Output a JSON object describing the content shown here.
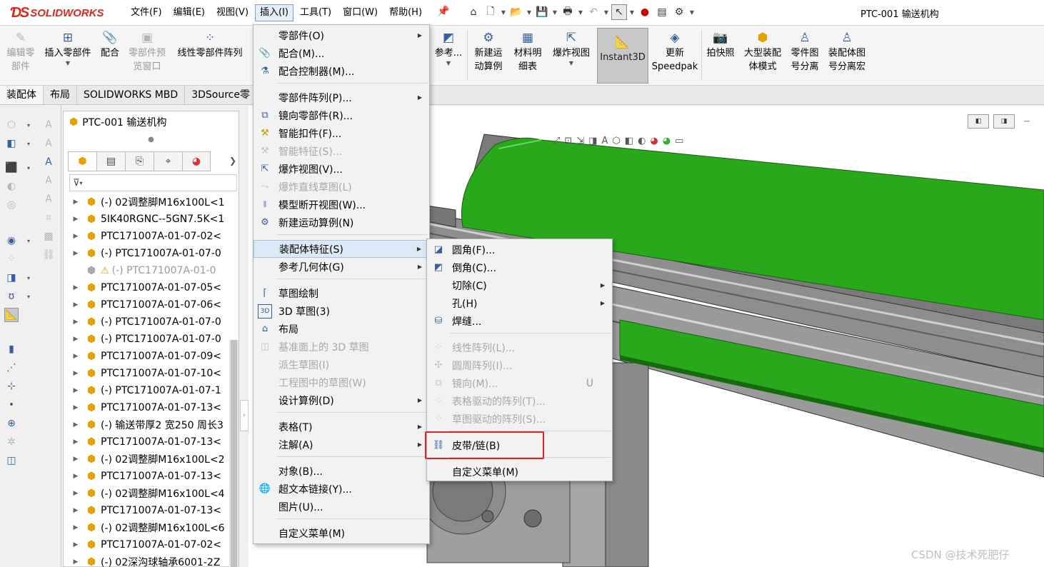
{
  "app": {
    "logo_text": "SOLIDWORKS",
    "doc_title": "PTC-001 输送机构"
  },
  "menubar": [
    "文件(F)",
    "编辑(E)",
    "视图(V)",
    "插入(I)",
    "工具(T)",
    "窗口(W)",
    "帮助(H)"
  ],
  "ribbon": {
    "edit_component": "编辑零\n部件",
    "insert_component": "插入零部件",
    "mate": "配合",
    "component_preview": "零部件预\n览窗口",
    "linear_pattern": "线性零部件阵列",
    "reference": "参考...",
    "new_motion_study": "新建运\n动算例",
    "bom": "材料明\n细表",
    "exploded_view": "爆炸视图",
    "instant3d": "Instant3D",
    "update_speedpak": "更新\nSpeedpak",
    "snapshot": "拍快照",
    "large_assembly_mode": "大型装配\n体模式",
    "part_id_split": "零件图\n号分离",
    "assembly_id_split": "装配体图\n号分离宏"
  },
  "tabs": [
    "装配体",
    "布局",
    "SOLIDWORKS MBD",
    "3DSource零"
  ],
  "tree": {
    "title": "PTC-001 输送机构",
    "items": [
      {
        "text": "(-) 02调整脚M16x100L<1",
        "state": "normal"
      },
      {
        "text": "5IK40RGNC--5GN7.5K<1",
        "state": "normal"
      },
      {
        "text": "PTC171007A-01-07-02<",
        "state": "normal"
      },
      {
        "text": "(-) PTC171007A-01-07-0",
        "state": "normal"
      },
      {
        "text": "(-) PTC171007A-01-0",
        "state": "warning"
      },
      {
        "text": "PTC171007A-01-07-05<",
        "state": "normal"
      },
      {
        "text": "PTC171007A-01-07-06<",
        "state": "normal"
      },
      {
        "text": "(-) PTC171007A-01-07-0",
        "state": "normal"
      },
      {
        "text": "(-) PTC171007A-01-07-0",
        "state": "normal"
      },
      {
        "text": "PTC171007A-01-07-09<",
        "state": "normal"
      },
      {
        "text": "PTC171007A-01-07-10<",
        "state": "normal"
      },
      {
        "text": "(-) PTC171007A-01-07-1",
        "state": "normal"
      },
      {
        "text": "PTC171007A-01-07-13<",
        "state": "normal"
      },
      {
        "text": "(-) 输送带厚2 宽250 周长3",
        "state": "normal"
      },
      {
        "text": "PTC171007A-01-07-13<",
        "state": "normal"
      },
      {
        "text": "(-) 02调整脚M16x100L<2",
        "state": "normal"
      },
      {
        "text": "PTC171007A-01-07-13<",
        "state": "normal"
      },
      {
        "text": "(-) 02调整脚M16x100L<4",
        "state": "normal"
      },
      {
        "text": "PTC171007A-01-07-13<",
        "state": "normal"
      },
      {
        "text": "(-) 02调整脚M16x100L<6",
        "state": "normal"
      },
      {
        "text": "PTC171007A-01-07-02<",
        "state": "normal"
      },
      {
        "text": "(-) 02深沟球轴承6001-2Z",
        "state": "normal"
      }
    ]
  },
  "insert_menu": {
    "items": [
      {
        "label": "零部件(O)",
        "icon": "component-icon",
        "submenu": true,
        "disabled": false
      },
      {
        "label": "配合(M)...",
        "icon": "mate-icon",
        "submenu": false,
        "disabled": false
      },
      {
        "label": "配合控制器(M)...",
        "icon": "mate-controller-icon",
        "submenu": false,
        "disabled": false
      },
      {
        "label": "零部件阵列(P)...",
        "icon": "",
        "submenu": true,
        "disabled": false
      },
      {
        "label": "镜向零部件(R)...",
        "icon": "mirror-icon",
        "submenu": false,
        "disabled": false
      },
      {
        "label": "智能扣件(F)...",
        "icon": "smart-fastener-icon",
        "submenu": false,
        "disabled": false
      },
      {
        "label": "智能特征(S)...",
        "icon": "smart-feature-icon",
        "submenu": false,
        "disabled": true
      },
      {
        "label": "爆炸视图(V)...",
        "icon": "explode-icon",
        "submenu": false,
        "disabled": false
      },
      {
        "label": "爆炸直线草图(L)",
        "icon": "explode-line-icon",
        "submenu": false,
        "disabled": true
      },
      {
        "label": "模型断开视图(W)...",
        "icon": "break-view-icon",
        "submenu": false,
        "disabled": false
      },
      {
        "label": "新建运动算例(N)",
        "icon": "motion-study-icon",
        "submenu": false,
        "disabled": false
      },
      {
        "label": "装配体特征(S)",
        "icon": "",
        "submenu": true,
        "disabled": false,
        "highlight": true
      },
      {
        "label": "参考几何体(G)",
        "icon": "",
        "submenu": true,
        "disabled": false
      },
      {
        "label": "草图绘制",
        "icon": "sketch-icon",
        "submenu": false,
        "disabled": false
      },
      {
        "label": "3D 草图(3)",
        "icon": "3d-sketch-icon",
        "submenu": false,
        "disabled": false
      },
      {
        "label": "布局",
        "icon": "layout-icon",
        "submenu": false,
        "disabled": false
      },
      {
        "label": "基准面上的 3D 草图",
        "icon": "3d-sketch-plane-icon",
        "submenu": false,
        "disabled": true
      },
      {
        "label": "派生草图(I)",
        "icon": "",
        "submenu": false,
        "disabled": true
      },
      {
        "label": "工程图中的草图(W)",
        "icon": "",
        "submenu": false,
        "disabled": true
      },
      {
        "label": "设计算例(D)",
        "icon": "",
        "submenu": true,
        "disabled": false
      },
      {
        "label": "表格(T)",
        "icon": "",
        "submenu": true,
        "disabled": false
      },
      {
        "label": "注解(A)",
        "icon": "",
        "submenu": true,
        "disabled": false
      },
      {
        "label": "对象(B)...",
        "icon": "",
        "submenu": false,
        "disabled": false
      },
      {
        "label": "超文本链接(Y)...",
        "icon": "hyperlink-icon",
        "submenu": false,
        "disabled": false
      },
      {
        "label": "图片(U)...",
        "icon": "",
        "submenu": false,
        "disabled": false
      },
      {
        "label": "自定义菜单(M)",
        "icon": "",
        "submenu": false,
        "disabled": false
      }
    ]
  },
  "assembly_feature_menu": {
    "items": [
      {
        "label": "圆角(F)...",
        "icon": "fillet-icon",
        "submenu": false,
        "disabled": false,
        "shortcut": ""
      },
      {
        "label": "倒角(C)...",
        "icon": "chamfer-icon",
        "submenu": false,
        "disabled": false,
        "shortcut": ""
      },
      {
        "label": "切除(C)",
        "icon": "",
        "submenu": true,
        "disabled": false,
        "shortcut": ""
      },
      {
        "label": "孔(H)",
        "icon": "",
        "submenu": true,
        "disabled": false,
        "shortcut": ""
      },
      {
        "label": "焊缝...",
        "icon": "weld-bead-icon",
        "submenu": false,
        "disabled": false,
        "shortcut": ""
      },
      {
        "label": "线性阵列(L)...",
        "icon": "linear-pattern-icon",
        "submenu": false,
        "disabled": true,
        "shortcut": ""
      },
      {
        "label": "圆周阵列(I)...",
        "icon": "circular-pattern-icon",
        "submenu": false,
        "disabled": true,
        "shortcut": ""
      },
      {
        "label": "镜向(M)...",
        "icon": "mirror-feature-icon",
        "submenu": false,
        "disabled": true,
        "shortcut": "U"
      },
      {
        "label": "表格驱动的阵列(T)...",
        "icon": "table-pattern-icon",
        "submenu": false,
        "disabled": true,
        "shortcut": ""
      },
      {
        "label": "草图驱动的阵列(S)...",
        "icon": "sketch-pattern-icon",
        "submenu": false,
        "disabled": true,
        "shortcut": ""
      },
      {
        "label": "皮带/链(B)",
        "icon": "belt-chain-icon",
        "submenu": false,
        "disabled": false,
        "shortcut": ""
      },
      {
        "label": "自定义菜单(M)",
        "icon": "",
        "submenu": false,
        "disabled": false,
        "shortcut": ""
      }
    ]
  },
  "watermark": "CSDN @技术死肥仔",
  "colors": {
    "belt_green": "#2aa81c",
    "frame_gray": "#8a8a8a",
    "highlight_red": "#e52222",
    "accent_blue": "#355f9e"
  }
}
